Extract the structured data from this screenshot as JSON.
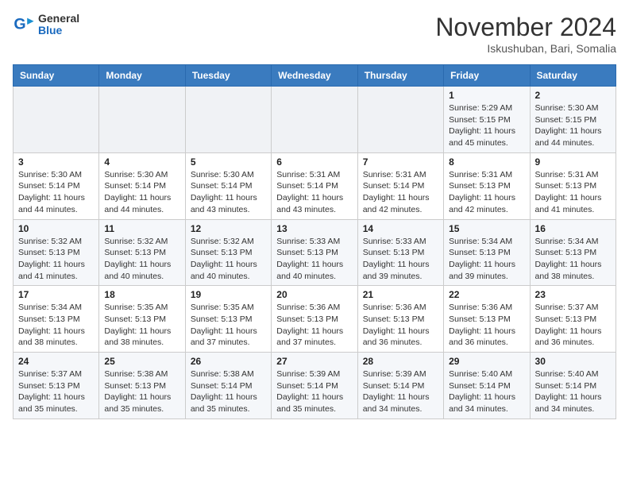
{
  "header": {
    "logo": {
      "general": "General",
      "blue": "Blue"
    },
    "title": "November 2024",
    "location": "Iskushuban, Bari, Somalia"
  },
  "calendar": {
    "days_of_week": [
      "Sunday",
      "Monday",
      "Tuesday",
      "Wednesday",
      "Thursday",
      "Friday",
      "Saturday"
    ],
    "weeks": [
      [
        {
          "day": "",
          "info": ""
        },
        {
          "day": "",
          "info": ""
        },
        {
          "day": "",
          "info": ""
        },
        {
          "day": "",
          "info": ""
        },
        {
          "day": "",
          "info": ""
        },
        {
          "day": "1",
          "info": "Sunrise: 5:29 AM\nSunset: 5:15 PM\nDaylight: 11 hours and 45 minutes."
        },
        {
          "day": "2",
          "info": "Sunrise: 5:30 AM\nSunset: 5:15 PM\nDaylight: 11 hours and 44 minutes."
        }
      ],
      [
        {
          "day": "3",
          "info": "Sunrise: 5:30 AM\nSunset: 5:14 PM\nDaylight: 11 hours and 44 minutes."
        },
        {
          "day": "4",
          "info": "Sunrise: 5:30 AM\nSunset: 5:14 PM\nDaylight: 11 hours and 44 minutes."
        },
        {
          "day": "5",
          "info": "Sunrise: 5:30 AM\nSunset: 5:14 PM\nDaylight: 11 hours and 43 minutes."
        },
        {
          "day": "6",
          "info": "Sunrise: 5:31 AM\nSunset: 5:14 PM\nDaylight: 11 hours and 43 minutes."
        },
        {
          "day": "7",
          "info": "Sunrise: 5:31 AM\nSunset: 5:14 PM\nDaylight: 11 hours and 42 minutes."
        },
        {
          "day": "8",
          "info": "Sunrise: 5:31 AM\nSunset: 5:13 PM\nDaylight: 11 hours and 42 minutes."
        },
        {
          "day": "9",
          "info": "Sunrise: 5:31 AM\nSunset: 5:13 PM\nDaylight: 11 hours and 41 minutes."
        }
      ],
      [
        {
          "day": "10",
          "info": "Sunrise: 5:32 AM\nSunset: 5:13 PM\nDaylight: 11 hours and 41 minutes."
        },
        {
          "day": "11",
          "info": "Sunrise: 5:32 AM\nSunset: 5:13 PM\nDaylight: 11 hours and 40 minutes."
        },
        {
          "day": "12",
          "info": "Sunrise: 5:32 AM\nSunset: 5:13 PM\nDaylight: 11 hours and 40 minutes."
        },
        {
          "day": "13",
          "info": "Sunrise: 5:33 AM\nSunset: 5:13 PM\nDaylight: 11 hours and 40 minutes."
        },
        {
          "day": "14",
          "info": "Sunrise: 5:33 AM\nSunset: 5:13 PM\nDaylight: 11 hours and 39 minutes."
        },
        {
          "day": "15",
          "info": "Sunrise: 5:34 AM\nSunset: 5:13 PM\nDaylight: 11 hours and 39 minutes."
        },
        {
          "day": "16",
          "info": "Sunrise: 5:34 AM\nSunset: 5:13 PM\nDaylight: 11 hours and 38 minutes."
        }
      ],
      [
        {
          "day": "17",
          "info": "Sunrise: 5:34 AM\nSunset: 5:13 PM\nDaylight: 11 hours and 38 minutes."
        },
        {
          "day": "18",
          "info": "Sunrise: 5:35 AM\nSunset: 5:13 PM\nDaylight: 11 hours and 38 minutes."
        },
        {
          "day": "19",
          "info": "Sunrise: 5:35 AM\nSunset: 5:13 PM\nDaylight: 11 hours and 37 minutes."
        },
        {
          "day": "20",
          "info": "Sunrise: 5:36 AM\nSunset: 5:13 PM\nDaylight: 11 hours and 37 minutes."
        },
        {
          "day": "21",
          "info": "Sunrise: 5:36 AM\nSunset: 5:13 PM\nDaylight: 11 hours and 36 minutes."
        },
        {
          "day": "22",
          "info": "Sunrise: 5:36 AM\nSunset: 5:13 PM\nDaylight: 11 hours and 36 minutes."
        },
        {
          "day": "23",
          "info": "Sunrise: 5:37 AM\nSunset: 5:13 PM\nDaylight: 11 hours and 36 minutes."
        }
      ],
      [
        {
          "day": "24",
          "info": "Sunrise: 5:37 AM\nSunset: 5:13 PM\nDaylight: 11 hours and 35 minutes."
        },
        {
          "day": "25",
          "info": "Sunrise: 5:38 AM\nSunset: 5:13 PM\nDaylight: 11 hours and 35 minutes."
        },
        {
          "day": "26",
          "info": "Sunrise: 5:38 AM\nSunset: 5:14 PM\nDaylight: 11 hours and 35 minutes."
        },
        {
          "day": "27",
          "info": "Sunrise: 5:39 AM\nSunset: 5:14 PM\nDaylight: 11 hours and 35 minutes."
        },
        {
          "day": "28",
          "info": "Sunrise: 5:39 AM\nSunset: 5:14 PM\nDaylight: 11 hours and 34 minutes."
        },
        {
          "day": "29",
          "info": "Sunrise: 5:40 AM\nSunset: 5:14 PM\nDaylight: 11 hours and 34 minutes."
        },
        {
          "day": "30",
          "info": "Sunrise: 5:40 AM\nSunset: 5:14 PM\nDaylight: 11 hours and 34 minutes."
        }
      ]
    ]
  }
}
